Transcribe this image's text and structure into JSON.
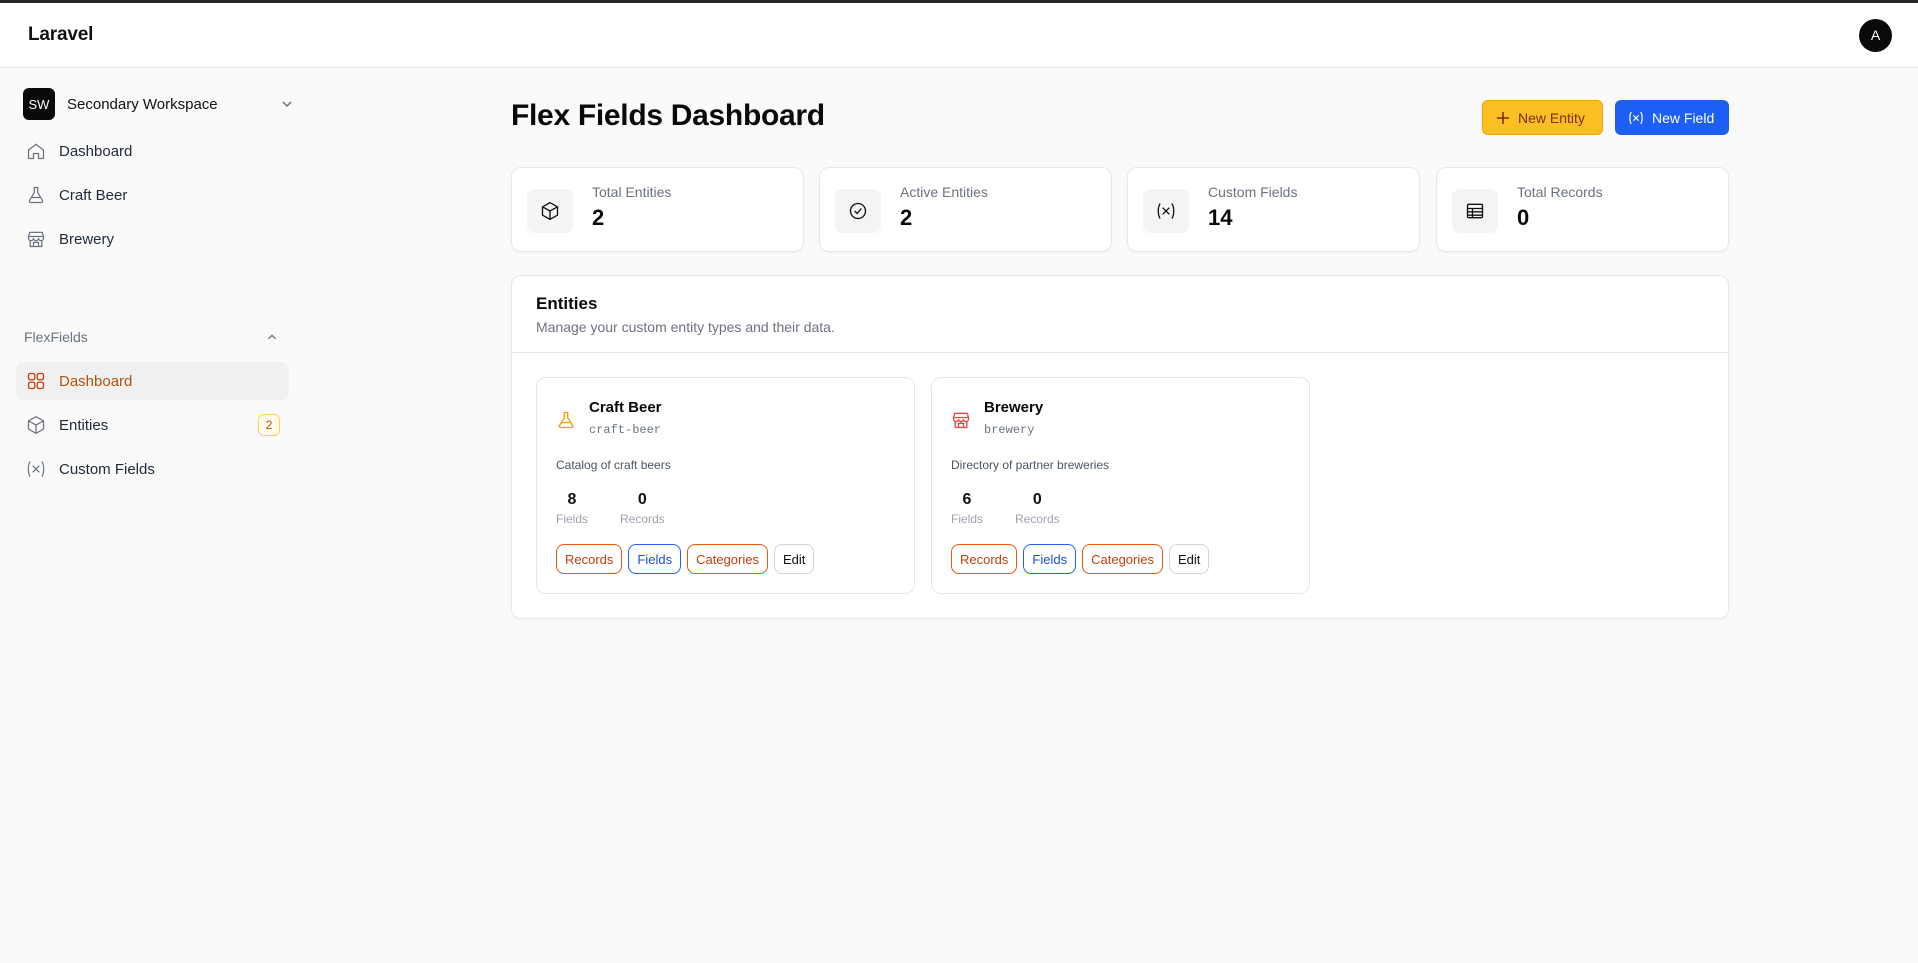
{
  "app": {
    "brand": "Laravel",
    "user_initial": "A"
  },
  "workspace": {
    "badge": "SW",
    "name": "Secondary Workspace"
  },
  "sidebar": {
    "items": [
      {
        "label": "Dashboard",
        "icon": "home-icon"
      },
      {
        "label": "Craft Beer",
        "icon": "flask-icon"
      },
      {
        "label": "Brewery",
        "icon": "store-icon"
      }
    ],
    "group_label": "FlexFields",
    "group_items": [
      {
        "label": "Dashboard",
        "icon": "grid-icon",
        "active": true
      },
      {
        "label": "Entities",
        "icon": "cube-icon",
        "badge": "2"
      },
      {
        "label": "Custom Fields",
        "icon": "variable-icon"
      }
    ]
  },
  "page": {
    "title": "Flex Fields Dashboard",
    "new_entity_label": "New Entity",
    "new_field_label": "New Field"
  },
  "stats": [
    {
      "label": "Total Entities",
      "value": "2",
      "icon": "cube-icon"
    },
    {
      "label": "Active Entities",
      "value": "2",
      "icon": "check-circle-icon"
    },
    {
      "label": "Custom Fields",
      "value": "14",
      "icon": "variable-icon"
    },
    {
      "label": "Total Records",
      "value": "0",
      "icon": "table-icon"
    }
  ],
  "entities_panel": {
    "title": "Entities",
    "subtitle": "Manage your custom entity types and their data.",
    "cards": [
      {
        "name": "Craft Beer",
        "slug": "craft-beer",
        "description": "Catalog of craft beers",
        "fields": "8",
        "fields_label": "Fields",
        "records": "0",
        "records_label": "Records",
        "icon": "flask-icon",
        "icon_color": "#f59e0b",
        "buttons": [
          "Records",
          "Fields",
          "Categories",
          "Edit"
        ]
      },
      {
        "name": "Brewery",
        "slug": "brewery",
        "description": "Directory of partner breweries",
        "fields": "6",
        "fields_label": "Fields",
        "records": "0",
        "records_label": "Records",
        "icon": "store-icon",
        "icon_color": "#ef4444",
        "buttons": [
          "Records",
          "Fields",
          "Categories",
          "Edit"
        ]
      }
    ]
  },
  "colors": {
    "accent_orange": "#c2410c",
    "primary_blue": "#1d5ef5",
    "amber": "#fbbf24"
  }
}
